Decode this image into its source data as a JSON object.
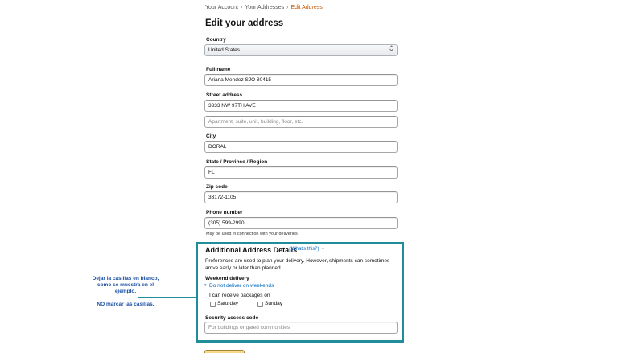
{
  "breadcrumb": {
    "items": [
      "Your Account",
      "Your Addresses",
      "Edit Address"
    ],
    "separator": "›"
  },
  "page": {
    "title": "Edit your address"
  },
  "form": {
    "country": {
      "label": "Country",
      "value": "United States"
    },
    "full_name": {
      "label": "Full name",
      "value": "Ariana Mendez SJO 80415"
    },
    "street": {
      "label": "Street address",
      "value": "3333 NW 97TH AVE",
      "line2_placeholder": "Apartment, suite, unit, building, floor, etc."
    },
    "city": {
      "label": "City",
      "value": "DORAL"
    },
    "state": {
      "label": "State / Province / Region",
      "value": "FL"
    },
    "zip": {
      "label": "Zip code",
      "value": "33172-1105"
    },
    "phone": {
      "label": "Phone number",
      "value": "(305) 599-2990",
      "hint": "May be used in connection with your deliveries"
    }
  },
  "additional_details": {
    "title": "Additional Address Details",
    "whats_this": "(What's this?)",
    "caret": "▾",
    "description": "Preferences are used to plan your delivery. However, shipments can sometimes arrive early or later than planned.",
    "weekend": {
      "label": "Weekend delivery",
      "toggle_caret": "▾",
      "toggle_text": "Do not deliver on weekends",
      "receive_text": "I can receive packages on",
      "saturday": "Saturday",
      "sunday": "Sunday"
    },
    "security": {
      "label": "Security access code",
      "placeholder": "For buildings or gated communities"
    }
  },
  "annotation": {
    "line1": "Dejar la casillas en blanco,",
    "line2": "como se muestra en el",
    "line3": "ejemplo.",
    "line4": "NO marcar las casillas."
  },
  "colors": {
    "highlight_border": "#1f8e9a",
    "link": "#0066c0",
    "breadcrumb_current": "#c45500",
    "annotation_text": "#1a4fa3",
    "button": "#f0c14b"
  },
  "icons": {
    "select_arrow": "up-down-chevron-icon",
    "whats_this_caret": "caret-down-icon",
    "weekend_caret": "caret-down-icon"
  }
}
